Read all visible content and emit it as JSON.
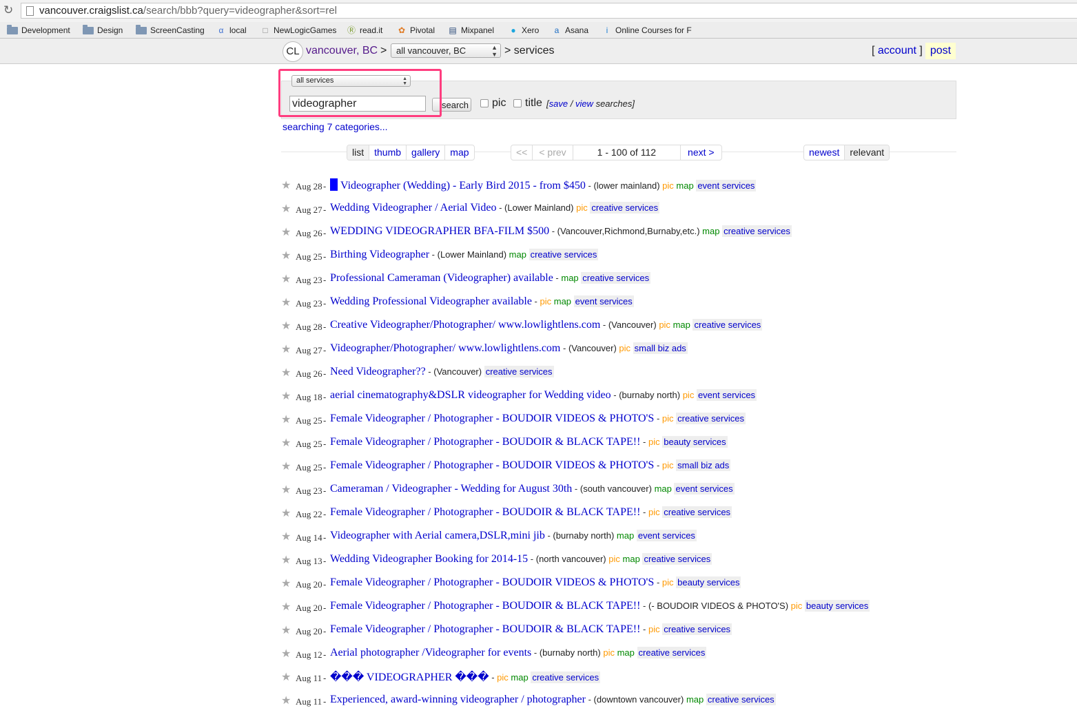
{
  "browser": {
    "url_host": "vancouver.craigslist.ca",
    "url_path": "/search/bbb?query=videographer&sort=rel",
    "bookmarks": [
      "Development",
      "Design",
      "ScreenCasting",
      "local",
      "NewLogicGames",
      "read.it",
      "Pivotal",
      "Mixpanel",
      "Xero",
      "Asana",
      "Online Courses for F"
    ]
  },
  "header": {
    "logo": "CL",
    "city": "vancouver, BC",
    "gt1": ">",
    "area": "all vancouver, BC",
    "section": "> services",
    "account_open": "[",
    "account": "account",
    "account_close": "]",
    "post": "post"
  },
  "search": {
    "category": "all services",
    "query": "videographer",
    "button": "search",
    "pic_label": "pic",
    "title_label": "title",
    "save": "save",
    "slash": " / ",
    "view": "view",
    "searches": " searches]",
    "open_bracket": "[",
    "searching": "searching 7 categories..."
  },
  "toolbar": {
    "views": [
      "list",
      "thumb",
      "gallery",
      "map"
    ],
    "first": "<<",
    "prev": "< prev",
    "range": "1 - 100 of 112",
    "next": "next >",
    "sort_newest": "newest",
    "sort_relevant": "relevant"
  },
  "listings": [
    {
      "date": "Aug 28",
      "title": "Videographer (Wedding) - Early Bird 2015 - from $450",
      "loc": "(lower mainland)",
      "pic": "pic",
      "map": "map",
      "cat": "event services"
    },
    {
      "date": "Aug 27",
      "title": "Wedding Videographer / Aerial Video",
      "loc": "(Lower Mainland)",
      "pic": "pic",
      "map": "",
      "cat": "creative services"
    },
    {
      "date": "Aug 26",
      "title": "WEDDING VIDEOGRAPHER BFA-FILM $500",
      "loc": "(Vancouver,Richmond,Burnaby,etc.)",
      "pic": "",
      "map": "map",
      "cat": "creative services"
    },
    {
      "date": "Aug 25",
      "title": "Birthing Videographer",
      "loc": "(Lower Mainland)",
      "pic": "",
      "map": "map",
      "cat": "creative services"
    },
    {
      "date": "Aug 23",
      "title": "Professional Cameraman (Videographer) available",
      "loc": "",
      "pic": "",
      "map": "map",
      "cat": "creative services"
    },
    {
      "date": "Aug 23",
      "title": "Wedding Professional Videographer available",
      "loc": "",
      "pic": "pic",
      "map": "map",
      "cat": "event services"
    },
    {
      "date": "Aug 28",
      "title": "Creative Videographer/Photographer/ www.lowlightlens.com",
      "loc": "(Vancouver)",
      "pic": "pic",
      "map": "map",
      "cat": "creative services"
    },
    {
      "date": "Aug 27",
      "title": "Videographer/Photographer/ www.lowlightlens.com",
      "loc": "(Vancouver)",
      "pic": "pic",
      "map": "",
      "cat": "small biz ads"
    },
    {
      "date": "Aug 26",
      "title": "Need Videographer??",
      "loc": "(Vancouver)",
      "pic": "",
      "map": "",
      "cat": "creative services"
    },
    {
      "date": "Aug 18",
      "title": "aerial cinematography&DSLR videographer for Wedding video",
      "loc": "(burnaby north)",
      "pic": "pic",
      "map": "",
      "cat": "event services"
    },
    {
      "date": "Aug 25",
      "title": "Female Videographer / Photographer - BOUDOIR VIDEOS & PHOTO'S",
      "loc": "",
      "pic": "pic",
      "map": "",
      "cat": "creative services"
    },
    {
      "date": "Aug 25",
      "title": "Female Videographer / Photographer - BOUDOIR & BLACK TAPE!!",
      "loc": "",
      "pic": "pic",
      "map": "",
      "cat": "beauty services"
    },
    {
      "date": "Aug 25",
      "title": "Female Videographer / Photographer - BOUDOIR VIDEOS & PHOTO'S",
      "loc": "",
      "pic": "pic",
      "map": "",
      "cat": "small biz ads"
    },
    {
      "date": "Aug 23",
      "title": "Cameraman / Videographer - Wedding for August 30th",
      "loc": "(south vancouver)",
      "pic": "",
      "map": "map",
      "cat": "event services"
    },
    {
      "date": "Aug 22",
      "title": "Female Videographer / Photographer - BOUDOIR & BLACK TAPE!!",
      "loc": "",
      "pic": "pic",
      "map": "",
      "cat": "creative services"
    },
    {
      "date": "Aug 14",
      "title": "Videographer with Aerial camera,DSLR,mini jib",
      "loc": "(burnaby north)",
      "pic": "",
      "map": "map",
      "cat": "event services"
    },
    {
      "date": "Aug 13",
      "title": "Wedding Videographer Booking for 2014-15",
      "loc": "(north vancouver)",
      "pic": "pic",
      "map": "map",
      "cat": "creative services"
    },
    {
      "date": "Aug 20",
      "title": "Female Videographer / Photographer - BOUDOIR VIDEOS & PHOTO'S",
      "loc": "",
      "pic": "pic",
      "map": "",
      "cat": "beauty services"
    },
    {
      "date": "Aug 20",
      "title": "Female Videographer / Photographer - BOUDOIR & BLACK TAPE!!",
      "loc": "(- BOUDOIR VIDEOS & PHOTO'S)",
      "pic": "pic",
      "map": "",
      "cat": "beauty services"
    },
    {
      "date": "Aug 20",
      "title": "Female Videographer / Photographer - BOUDOIR & BLACK TAPE!!",
      "loc": "",
      "pic": "pic",
      "map": "",
      "cat": "creative services"
    },
    {
      "date": "Aug 12",
      "title": "Aerial photographer /Videographer for events",
      "loc": "(burnaby north)",
      "pic": "pic",
      "map": "map",
      "cat": "creative services"
    },
    {
      "date": "Aug 11",
      "title": "��� VIDEOGRAPHER ���",
      "loc": "",
      "pic": "pic",
      "map": "map",
      "cat": "creative services"
    },
    {
      "date": "Aug 11",
      "title": "Experienced, award-winning videographer / photographer",
      "loc": "(downtown vancouver)",
      "pic": "",
      "map": "map",
      "cat": "creative services"
    }
  ],
  "colors": {
    "link": "#0000cc",
    "pic": "#ff9900",
    "map": "#008800",
    "highlight": "#ff3d7f"
  }
}
